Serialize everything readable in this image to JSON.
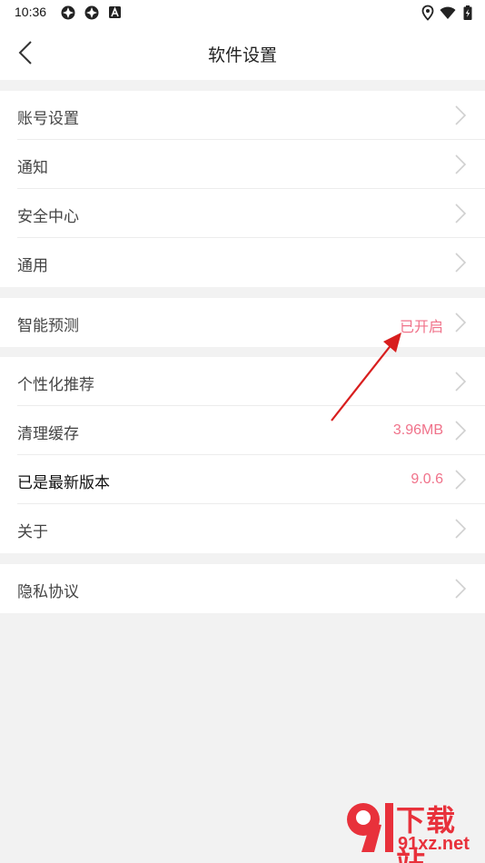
{
  "status_bar": {
    "time": "10:36",
    "icons": [
      "app-icon-1",
      "app-icon-2",
      "font-a-icon",
      "location-icon",
      "wifi-icon",
      "battery-charging-icon"
    ]
  },
  "header": {
    "title": "软件设置",
    "back_icon": "chevron-left-icon"
  },
  "groups": [
    {
      "items": [
        {
          "label": "账号设置",
          "value": ""
        },
        {
          "label": "通知",
          "value": ""
        },
        {
          "label": "安全中心",
          "value": ""
        },
        {
          "label": "通用",
          "value": ""
        }
      ]
    },
    {
      "items": [
        {
          "label": "智能预测",
          "value": "已开启"
        }
      ]
    },
    {
      "items": [
        {
          "label": "个性化推荐",
          "value": ""
        },
        {
          "label": "清理缓存",
          "value": "3.96MB"
        },
        {
          "label": "已是最新版本",
          "value": "9.0.6"
        },
        {
          "label": "关于",
          "value": ""
        }
      ]
    },
    {
      "items": [
        {
          "label": "隐私协议",
          "value": ""
        }
      ]
    }
  ],
  "colors": {
    "accent_value": "#f0728a",
    "annotation_arrow": "#d81e1e",
    "watermark": "#e8313b"
  },
  "watermark": {
    "logo_text": "9",
    "title": "下载站",
    "domain": "91xz.net"
  }
}
